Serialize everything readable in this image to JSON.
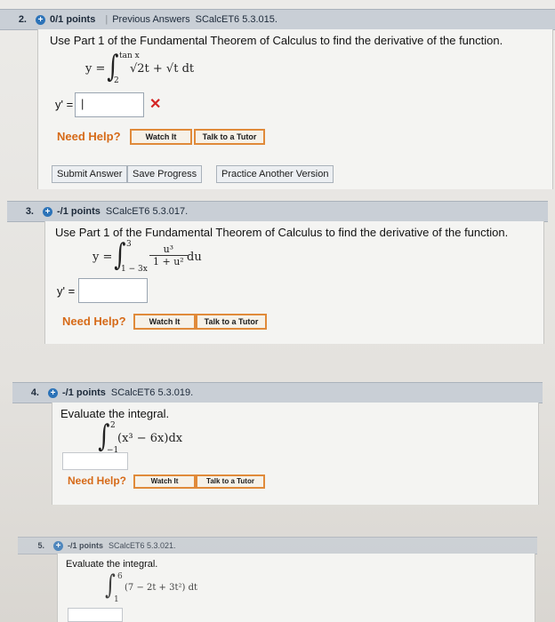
{
  "q2": {
    "num": "2.",
    "points": "0/1 points",
    "separator": "|",
    "prev": "Previous Answers",
    "code": "SCalcET6 5.3.015.",
    "prompt": "Use Part 1 of the Fundamental Theorem of Calculus to find the derivative of the function.",
    "eq_lhs": "y =",
    "upper": "tan x",
    "lower": "2",
    "integrand": "√2t + √t  dt",
    "answer_label": "y' =",
    "answer_value": "|",
    "wrong_mark": "✕",
    "help": "Need Help?",
    "watch": "Watch It",
    "tutor": "Talk to a Tutor",
    "submit": "Submit Answer",
    "save": "Save Progress",
    "practice": "Practice Another Version"
  },
  "q3": {
    "num": "3.",
    "points": "-/1 points",
    "code": "SCalcET6 5.3.017.",
    "prompt": "Use Part 1 of the Fundamental Theorem of Calculus to find the derivative of the function.",
    "eq_lhs": "y =",
    "upper": "3",
    "lower": "1 − 3x",
    "numerator": "u³",
    "denominator": "1 + u²",
    "diff": "du",
    "answer_label": "y' =",
    "help": "Need Help?",
    "watch": "Watch It",
    "tutor": "Talk to a Tutor"
  },
  "q4": {
    "num": "4.",
    "points": "-/1 points",
    "code": "SCalcET6 5.3.019.",
    "prompt": "Evaluate the integral.",
    "upper": "2",
    "lower": "−1",
    "integrand": "(x³ − 6x)dx",
    "help": "Need Help?",
    "watch": "Watch It",
    "tutor": "Talk to a Tutor"
  },
  "q5": {
    "num": "5.",
    "points": "-/1 points",
    "code": "SCalcET6 5.3.021.",
    "prompt": "Evaluate the integral.",
    "upper": "6",
    "lower": "1",
    "integrand": "(7 − 2t + 3t²) dt"
  }
}
